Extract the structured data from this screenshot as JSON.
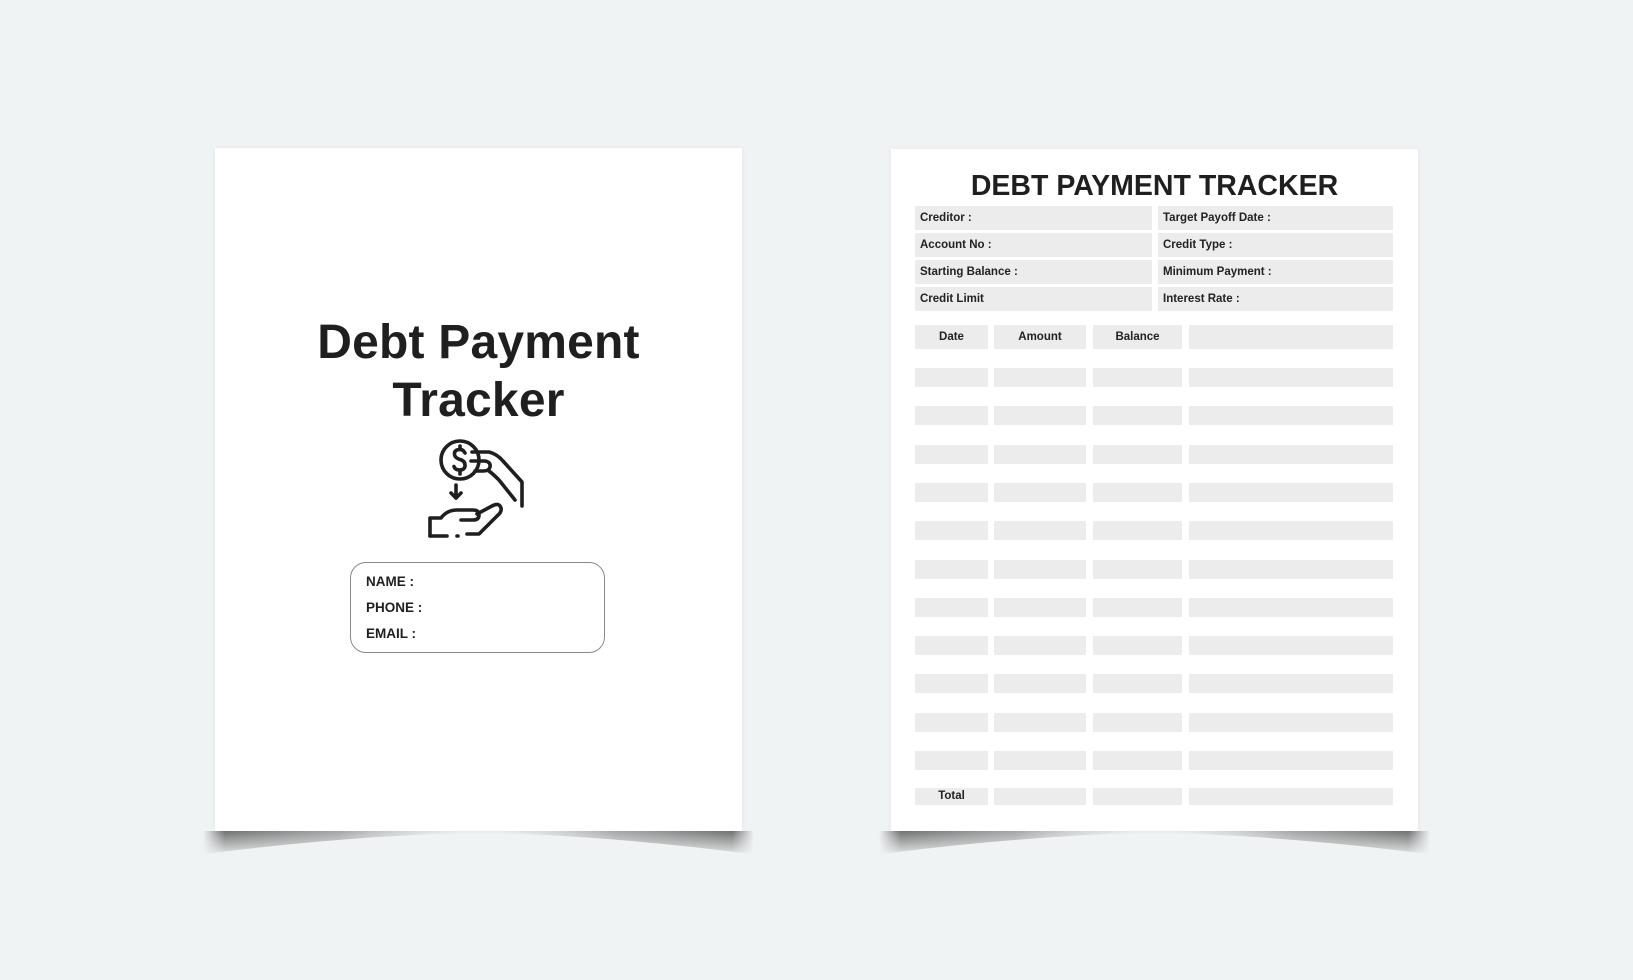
{
  "cover": {
    "title_line1": "Debt Payment",
    "title_line2": "Tracker",
    "icon": "hand-giving-dollar-coin-icon",
    "fields": [
      {
        "label": "NAME :",
        "value": ""
      },
      {
        "label": "PHONE :",
        "value": ""
      },
      {
        "label": "EMAIL :",
        "value": ""
      }
    ]
  },
  "tracker": {
    "title": "DEBT PAYMENT TRACKER",
    "info_fields_left": [
      {
        "label": "Creditor :",
        "value": ""
      },
      {
        "label": "Account No :",
        "value": ""
      },
      {
        "label": "Starting Balance :",
        "value": ""
      },
      {
        "label": "Credit Limit",
        "value": ""
      }
    ],
    "info_fields_right": [
      {
        "label": "Target Payoff Date :",
        "value": ""
      },
      {
        "label": "Credit Type :",
        "value": ""
      },
      {
        "label": "Minimum Payment :",
        "value": ""
      },
      {
        "label": "Interest Rate :",
        "value": ""
      }
    ],
    "table": {
      "columns": [
        "Date",
        "Amount",
        "Balance",
        ""
      ],
      "rows": [
        [
          "",
          "",
          "",
          ""
        ],
        [
          "",
          "",
          "",
          ""
        ],
        [
          "",
          "",
          "",
          ""
        ],
        [
          "",
          "",
          "",
          ""
        ],
        [
          "",
          "",
          "",
          ""
        ],
        [
          "",
          "",
          "",
          ""
        ],
        [
          "",
          "",
          "",
          ""
        ],
        [
          "",
          "",
          "",
          ""
        ],
        [
          "",
          "",
          "",
          ""
        ],
        [
          "",
          "",
          "",
          ""
        ],
        [
          "",
          "",
          "",
          ""
        ]
      ],
      "total_label": "Total",
      "total_values": [
        "",
        "",
        ""
      ]
    }
  },
  "colors": {
    "background": "#f0f3f4",
    "page": "#ffffff",
    "cell_fill": "#ececec",
    "text": "#1f1f1f",
    "box_border": "#8a8a8a"
  }
}
